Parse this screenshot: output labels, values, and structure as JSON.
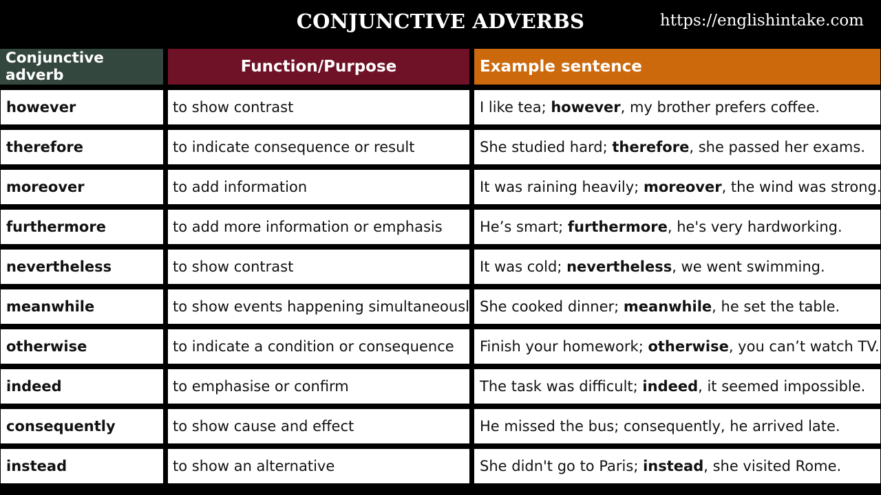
{
  "header": {
    "title": "CONJUNCTIVE ADVERBS",
    "url": "https://englishintake.com"
  },
  "colors": {
    "col1_header": "#34473e",
    "col2_header": "#6f1227",
    "col3_header": "#cc690d",
    "background": "#000000"
  },
  "table": {
    "columns": [
      "Conjunctive adverb",
      "Function/Purpose",
      "Example sentence"
    ],
    "rows": [
      {
        "adverb": "however",
        "function": "to show contrast",
        "before": "I like tea; ",
        "bold": "however",
        "after": ", my brother prefers coffee."
      },
      {
        "adverb": "therefore",
        "function": "to indicate consequence or result",
        "before": "She studied hard; ",
        "bold": "therefore",
        "after": ", she passed her exams."
      },
      {
        "adverb": "moreover",
        "function": "to add information",
        "before": "It was raining heavily; ",
        "bold": "moreover",
        "after": ", the wind was strong."
      },
      {
        "adverb": "furthermore",
        "function": "to add more information or emphasis",
        "before": "He’s smart; ",
        "bold": "furthermore",
        "after": ", he's very hardworking."
      },
      {
        "adverb": "nevertheless",
        "function": "to show contrast",
        "before": "It was cold; ",
        "bold": "nevertheless",
        "after": ", we went swimming."
      },
      {
        "adverb": "meanwhile",
        "function": "to show events happening simultaneously",
        "before": "She cooked dinner; ",
        "bold": "meanwhile",
        "after": ", he set the table."
      },
      {
        "adverb": "otherwise",
        "function": "to indicate a condition or consequence",
        "before": "Finish your homework; ",
        "bold": "otherwise",
        "after": ", you can’t watch TV."
      },
      {
        "adverb": "indeed",
        "function": "to emphasise or confirm",
        "before": "The task was difficult; ",
        "bold": "indeed",
        "after": ", it seemed impossible."
      },
      {
        "adverb": "consequently",
        "function": "to show cause and effect",
        "before": "He missed the bus; consequently, he arrived late.",
        "bold": "",
        "after": ""
      },
      {
        "adverb": "instead",
        "function": "to show an alternative",
        "before": "She didn't go to Paris; ",
        "bold": "instead",
        "after": ", she visited Rome."
      }
    ]
  }
}
